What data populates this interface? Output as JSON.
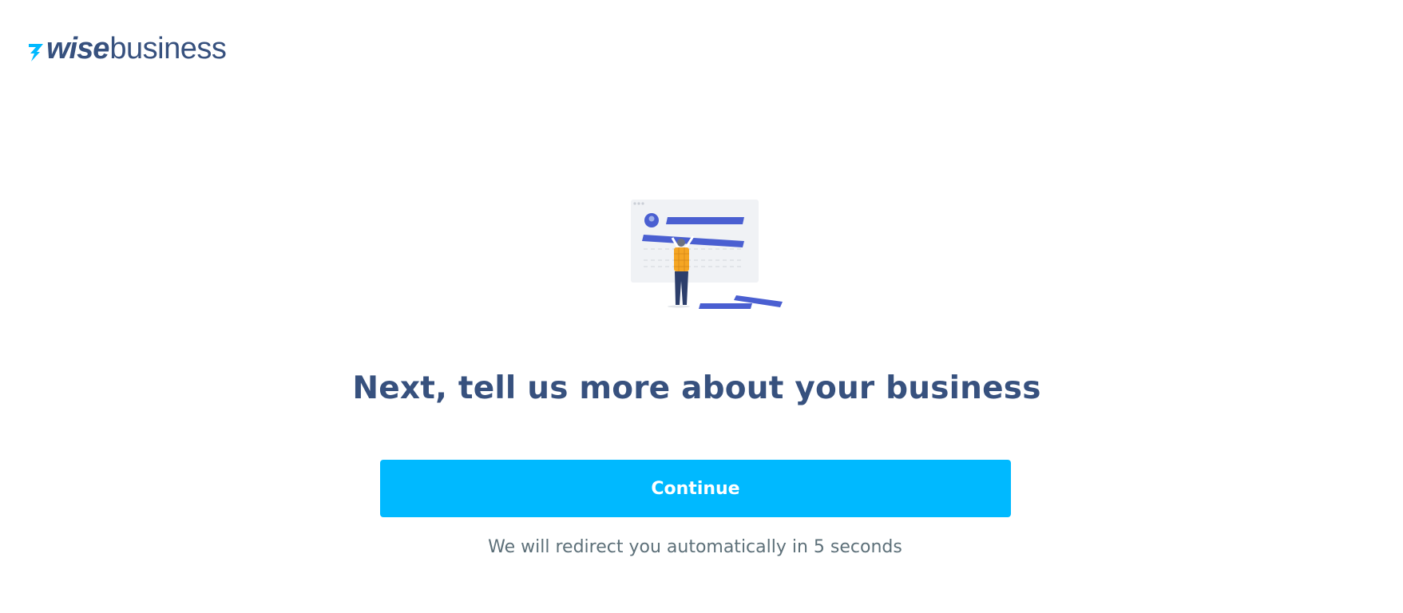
{
  "header": {
    "logo_wise": "wise",
    "logo_business": "business"
  },
  "main": {
    "headline": "Next, tell us more about your business",
    "continue_label": "Continue",
    "redirect_note": "We will redirect you automatically in 5 seconds"
  },
  "colors": {
    "brand_navy": "#37517e",
    "brand_blue": "#00b9ff",
    "text_muted": "#5d7079",
    "illustration_accent": "#4a5fd1"
  },
  "icons": {
    "logo_mark": "wise-flag-icon",
    "illustration": "business-form-illustration"
  }
}
